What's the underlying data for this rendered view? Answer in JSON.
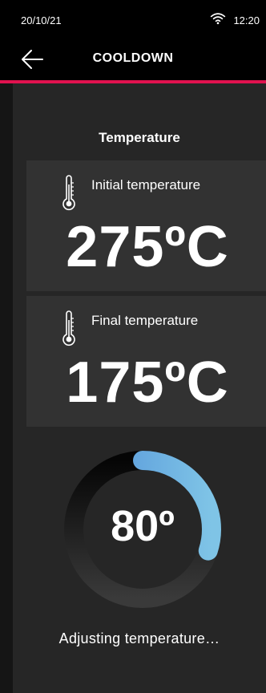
{
  "status_bar": {
    "date": "20/10/21",
    "time": "12:20",
    "wifi_icon": "wifi-icon"
  },
  "app_bar": {
    "title": "COOLDOWN",
    "back_icon": "arrow-left-icon",
    "accent_color": "#e0124f"
  },
  "section": {
    "title": "Temperature"
  },
  "initial": {
    "label": "Initial temperature",
    "value": "275ºC",
    "icon": "thermometer-icon"
  },
  "final": {
    "label": "Final temperature",
    "value": "175ºC",
    "icon": "thermometer-icon"
  },
  "gauge": {
    "value": "80º",
    "progress_fraction": 0.3,
    "colors": [
      "#4f8fd9",
      "#7fc4e6"
    ]
  },
  "status": {
    "text": "Adjusting temperature…"
  }
}
